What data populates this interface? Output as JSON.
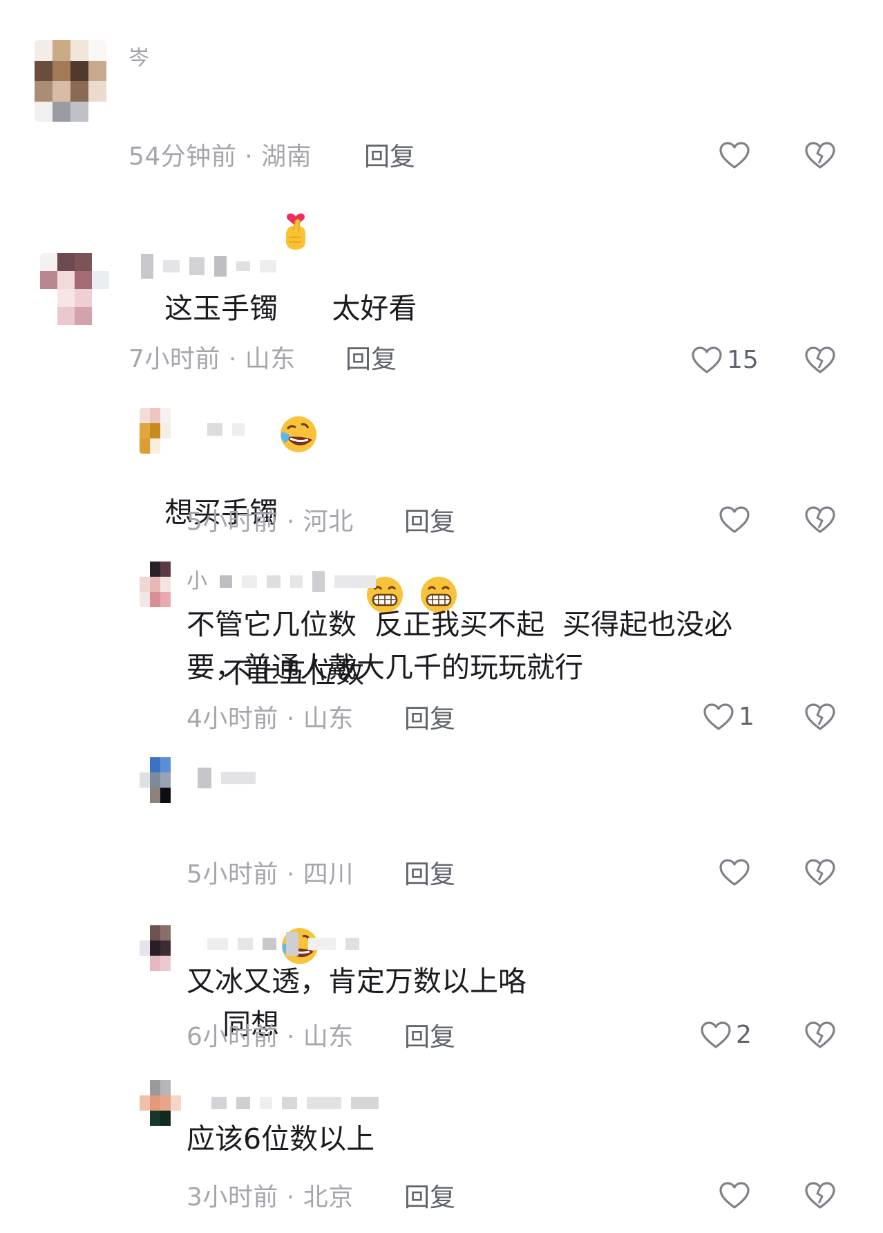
{
  "colors": {
    "text": "#1a1a1f",
    "meta": "#a4a6ac",
    "reply": "#5f636b",
    "icon": "#7d8088"
  },
  "comments": [
    {
      "text": "这玉手镯",
      "text_after": "太好看",
      "username_hint": "岑",
      "time_location": "54分钟前 · 湖南",
      "reply_label": "回复",
      "likes": "",
      "emojis": [
        "finger-heart-emoji"
      ]
    },
    {
      "text": "想买手镯",
      "username_hint": "",
      "time_location": "7小时前 · 山东",
      "reply_label": "回复",
      "likes": "15",
      "emojis": [
        "rolling-laugh-emoji"
      ]
    },
    {
      "text": "不止五位数",
      "username_hint": "",
      "time_location": "5小时前 · 河北",
      "reply_label": "回复",
      "likes": "",
      "emojis": [
        "grin-emoji",
        "grin-emoji"
      ]
    },
    {
      "text": "不管它几位数  反正我买不起  买得起也没必\n要，普通人戴大几千的玩玩就行",
      "username_hint": "小",
      "time_location": "4小时前 · 山东",
      "reply_label": "回复",
      "likes": "1"
    },
    {
      "text": "同想",
      "username_hint": "",
      "time_location": "5小时前 · 四川",
      "reply_label": "回复",
      "likes": "",
      "emojis": [
        "rolling-laugh-emoji"
      ]
    },
    {
      "text": "又冰又透，肯定万数以上咯",
      "username_hint": "",
      "time_location": "6小时前 · 山东",
      "reply_label": "回复",
      "likes": "2"
    },
    {
      "text": "应该6位数以上",
      "username_hint": "",
      "time_location": "3小时前 · 北京",
      "reply_label": "回复",
      "likes": ""
    }
  ]
}
